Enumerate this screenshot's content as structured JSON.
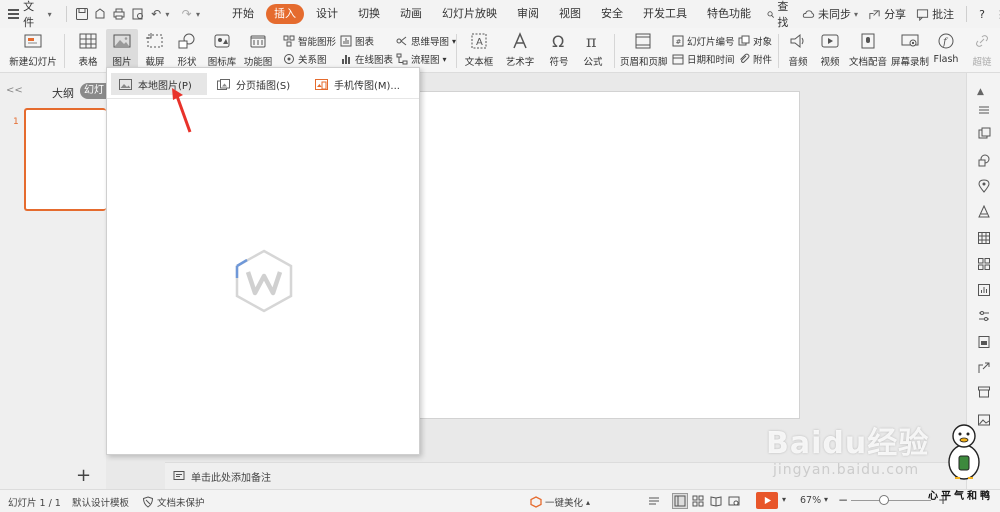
{
  "menubar": {
    "file_label": "文件",
    "tabs": [
      "开始",
      "插入",
      "设计",
      "切换",
      "动画",
      "幻灯片放映",
      "审阅",
      "视图",
      "安全",
      "开发工具",
      "特色功能"
    ],
    "active_tab": "插入",
    "search_label": "查找",
    "sync_label": "未同步",
    "share_label": "分享",
    "comment_label": "批注",
    "help_label": "?"
  },
  "ribbon": {
    "new_slide": "新建幻灯片",
    "table": "表格",
    "picture": "图片",
    "screenshot": "截屏",
    "shape": "形状",
    "icon_library": "图标库",
    "function_chart": "功能图",
    "smart_art": "智能图形",
    "chart": "图表",
    "mind_map": "思维导图",
    "relation_chart": "关系图",
    "online_chart": "在线图表",
    "flowchart": "流程图",
    "textbox": "文本框",
    "wordart": "艺术字",
    "symbol": "符号",
    "formula": "公式",
    "header_footer": "页眉和页脚",
    "slide_number": "幻灯片编号",
    "object": "对象",
    "date_time": "日期和时间",
    "attachment": "附件",
    "audio": "音频",
    "video": "视频",
    "doc_voice": "文档配音",
    "screen_record": "屏幕录制",
    "flash": "Flash",
    "last_item": "超链"
  },
  "left_panel": {
    "collapse_glyph": "<<",
    "outline_tab": "大纲",
    "slides_tab": "幻灯片",
    "slide_number": "1",
    "add_glyph": "+"
  },
  "dropdown": {
    "items": [
      "本地图片(P)",
      "分页插图(S)",
      "手机传图(M)..."
    ],
    "highlighted": "本地图片(P)"
  },
  "notes": {
    "placeholder": "单击此处添加备注"
  },
  "statusbar": {
    "slide_counter": "幻灯片 1 / 1",
    "template": "默认设计模板",
    "protect": "文档未保护",
    "beautify": "一键美化",
    "zoom": "67%",
    "zoom_minus": "−",
    "zoom_plus": "+"
  },
  "watermark": {
    "brand": "Baidu经验",
    "url": "jingyan.baidu.com",
    "signature": "心平气和鸭"
  },
  "colors": {
    "accent": "#e56b2e",
    "arrow": "#e8322a",
    "play": "#e8562a"
  }
}
